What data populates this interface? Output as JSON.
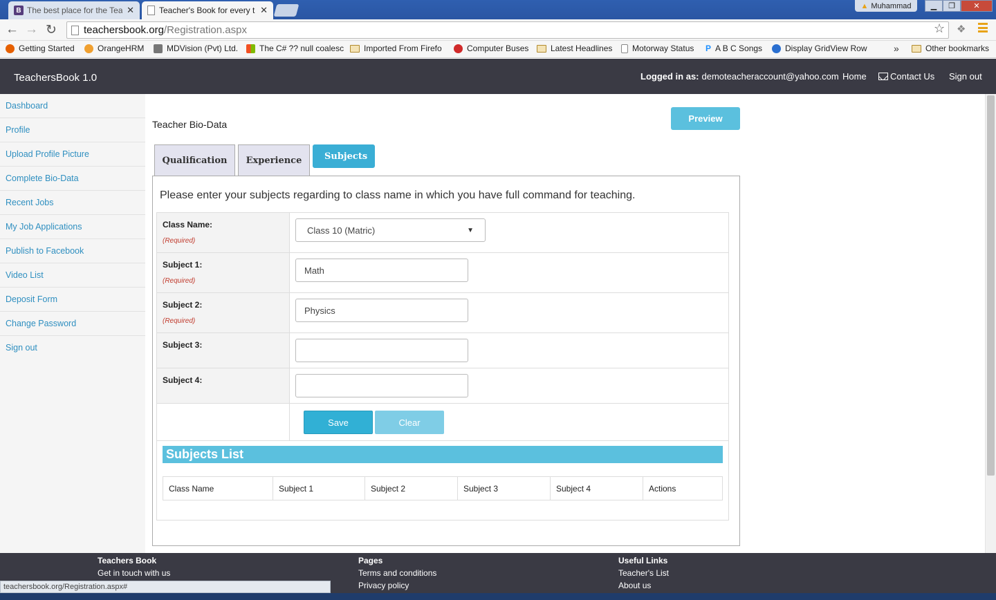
{
  "browser": {
    "tabs": [
      {
        "label": "The best place for the Tea",
        "icon": "bootstrap-b-icon"
      },
      {
        "label": "Teacher's Book for every t",
        "icon": "page-icon"
      }
    ],
    "user_badge": "Muhammad",
    "url_host": "teachersbook.org",
    "url_path": "/Registration.aspx",
    "bookmarks": [
      "Getting Started",
      "OrangeHRM",
      "MDVision (Pvt) Ltd.",
      "The C# ?? null coalesc",
      "Imported From Firefo",
      "Computer Buses",
      "Latest Headlines",
      "Motorway Status",
      "A B C Songs",
      "Display GridView Row"
    ],
    "bookmarks_more": "»",
    "other_bookmarks": "Other bookmarks",
    "status_url": "teachersbook.org/Registration.aspx#"
  },
  "header": {
    "brand": "TeachersBook 1.0",
    "logged_in_label": "Logged in as:",
    "logged_in_email": "demoteacheraccount@yahoo.com",
    "home": "Home",
    "contact": "Contact Us",
    "signout": "Sign out"
  },
  "sidebar": {
    "items": [
      "Dashboard",
      "Profile",
      "Upload Profile Picture",
      "Complete Bio-Data",
      "Recent Jobs",
      "My Job Applications",
      "Publish to Facebook",
      "Video List",
      "Deposit Form",
      "Change Password",
      "Sign out"
    ]
  },
  "main": {
    "title": "Teacher Bio-Data",
    "preview": "Preview",
    "tabs": [
      "Qualification",
      "Experience",
      "Subjects"
    ],
    "active_tab": "Subjects",
    "instruction": "Please enter your subjects regarding to class name in which you have full command for teaching.",
    "required_text": "(Required)",
    "form": {
      "class_label": "Class Name:",
      "class_value": "Class 10 (Matric)",
      "subject1_label": "Subject 1:",
      "subject1_value": "Math",
      "subject2_label": "Subject 2:",
      "subject2_value": "Physics",
      "subject3_label": "Subject 3:",
      "subject3_value": "",
      "subject4_label": "Subject 4:",
      "subject4_value": ""
    },
    "save": "Save",
    "clear": "Clear",
    "list_title": "Subjects List",
    "list_columns": [
      "Class Name",
      "Subject 1",
      "Subject 2",
      "Subject 3",
      "Subject 4",
      "Actions"
    ]
  },
  "footer": {
    "col1_title": "Teachers Book",
    "col1_items": [
      "Get in touch with us"
    ],
    "col2_title": "Pages",
    "col2_items": [
      "Terms and conditions",
      "Privacy policy"
    ],
    "col3_title": "Useful Links",
    "col3_items": [
      "Teacher's List",
      "About us"
    ]
  },
  "colors": {
    "header_bg": "#3a3a44",
    "accent": "#5bc0de",
    "link": "#2f8fc0",
    "required": "#c0392b"
  }
}
